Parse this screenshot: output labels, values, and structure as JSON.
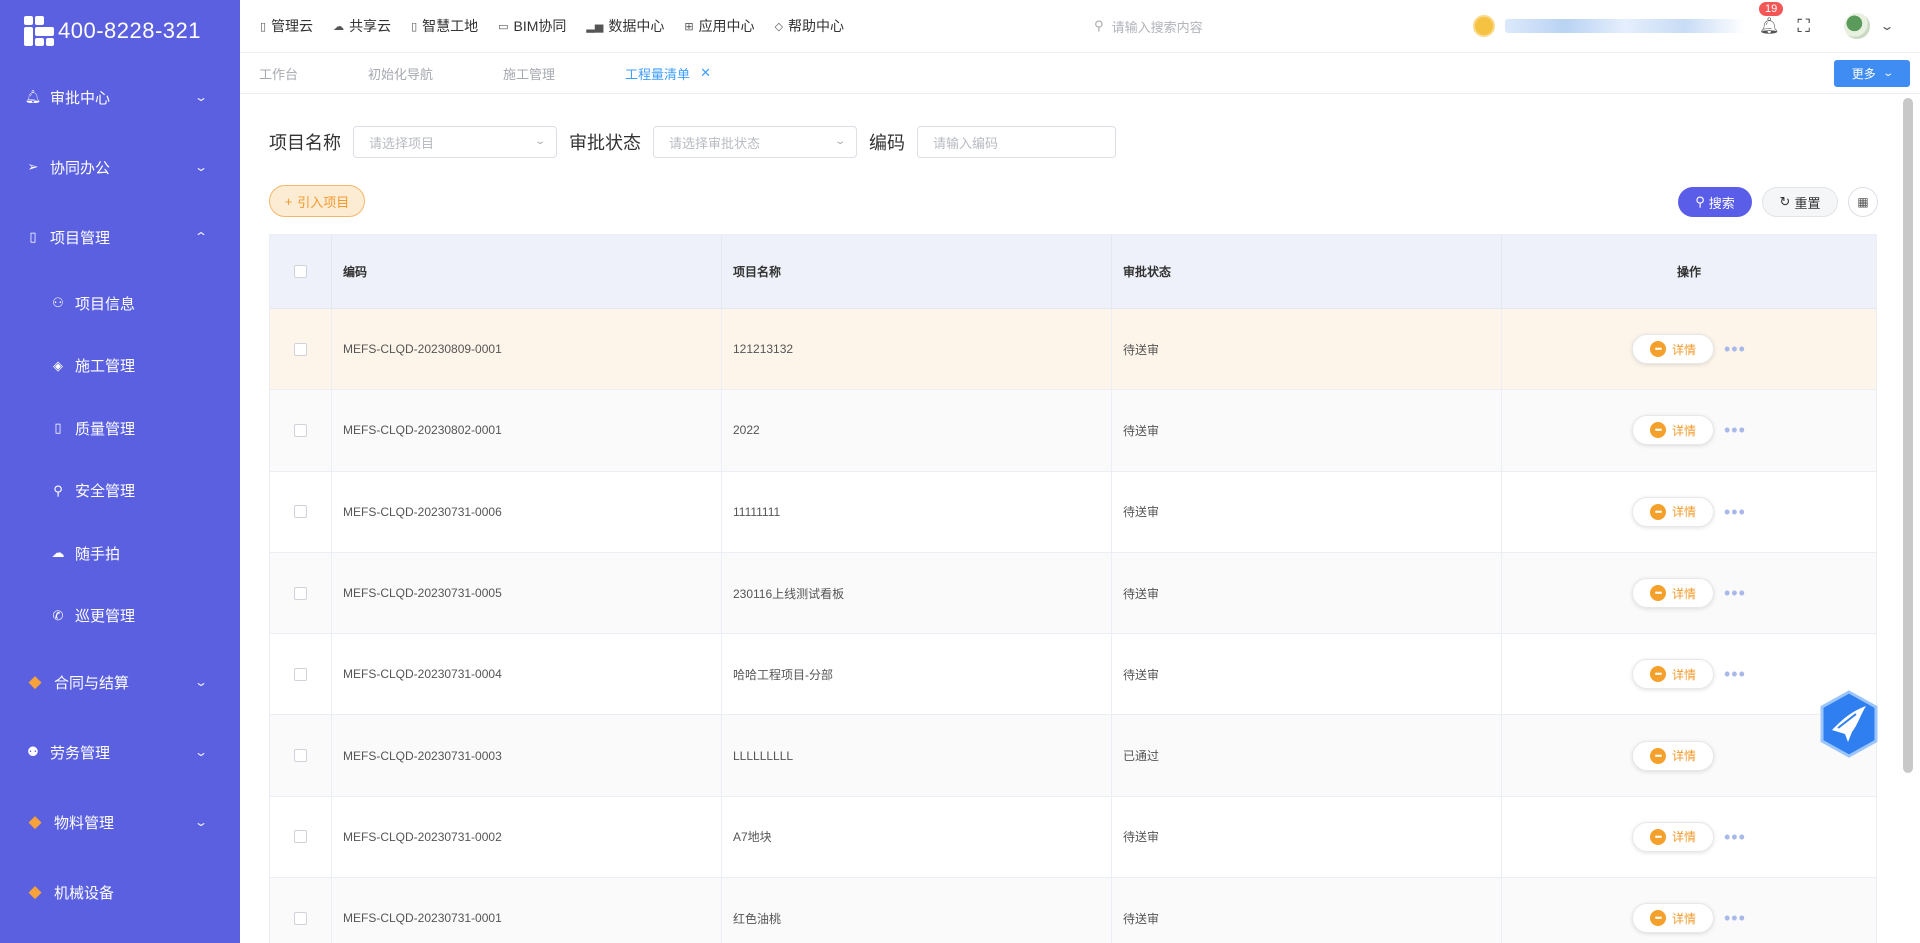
{
  "brand": {
    "phone": "400-8228-321"
  },
  "sidebar": {
    "groups": [
      {
        "label": "审批中心",
        "icon": "bell-icon",
        "expanded": false
      },
      {
        "label": "协同办公",
        "icon": "send-icon",
        "expanded": false
      },
      {
        "label": "项目管理",
        "icon": "book-icon",
        "expanded": true,
        "items": [
          {
            "label": "项目信息",
            "icon": "glasses-icon"
          },
          {
            "label": "施工管理",
            "icon": "tag-icon"
          },
          {
            "label": "质量管理",
            "icon": "book-icon"
          },
          {
            "label": "安全管理",
            "icon": "pin-icon"
          },
          {
            "label": "随手拍",
            "icon": "cloud-icon"
          },
          {
            "label": "巡更管理",
            "icon": "phone-icon"
          }
        ]
      },
      {
        "label": "合同与结算",
        "icon": "gem-icon",
        "expanded": false
      },
      {
        "label": "劳务管理",
        "icon": "user-icon",
        "expanded": false
      },
      {
        "label": "物料管理",
        "icon": "gem-icon",
        "expanded": false
      },
      {
        "label": "机械设备",
        "icon": "gem-icon",
        "expanded": false
      }
    ]
  },
  "topnav": {
    "items": [
      "管理云",
      "共享云",
      "智慧工地",
      "BIM协同",
      "数据中心",
      "应用中心",
      "帮助中心"
    ],
    "search_placeholder": "请输入搜索内容",
    "notification_count": "19"
  },
  "tabs": {
    "items": [
      "工作台",
      "初始化导航",
      "施工管理"
    ],
    "active": "工程量清单",
    "more_label": "更多"
  },
  "filters": {
    "project_label": "项目名称",
    "project_placeholder": "请选择项目",
    "status_label": "审批状态",
    "status_placeholder": "请选择审批状态",
    "code_label": "编码",
    "code_placeholder": "请输入编码"
  },
  "actions": {
    "import_label": "引入项目",
    "search_label": "搜索",
    "reset_label": "重置"
  },
  "table": {
    "headers": {
      "code": "编码",
      "name": "项目名称",
      "status": "审批状态",
      "ops": "操作"
    },
    "detail_label": "详情",
    "rows": [
      {
        "code": "MEFS-CLQD-20230809-0001",
        "name": "121213132",
        "status": "待送审",
        "has_more": true
      },
      {
        "code": "MEFS-CLQD-20230802-0001",
        "name": "2022",
        "status": "待送审",
        "has_more": true
      },
      {
        "code": "MEFS-CLQD-20230731-0006",
        "name": "11111111",
        "status": "待送审",
        "has_more": true
      },
      {
        "code": "MEFS-CLQD-20230731-0005",
        "name": "230116上线测试看板",
        "status": "待送审",
        "has_more": true
      },
      {
        "code": "MEFS-CLQD-20230731-0004",
        "name": "哈哈工程项目-分部",
        "status": "待送审",
        "has_more": true
      },
      {
        "code": "MEFS-CLQD-20230731-0003",
        "name": "LLLLLLLLL",
        "status": "已通过",
        "has_more": false
      },
      {
        "code": "MEFS-CLQD-20230731-0002",
        "name": "A7地块",
        "status": "待送审",
        "has_more": true
      },
      {
        "code": "MEFS-CLQD-20230731-0001",
        "name": "红色油桃",
        "status": "待送审",
        "has_more": true
      }
    ]
  },
  "colors": {
    "sidebar_bg": "#5a60e0",
    "primary": "#5a5de8",
    "accent_orange": "#f39a2b",
    "link_blue": "#409eff"
  }
}
